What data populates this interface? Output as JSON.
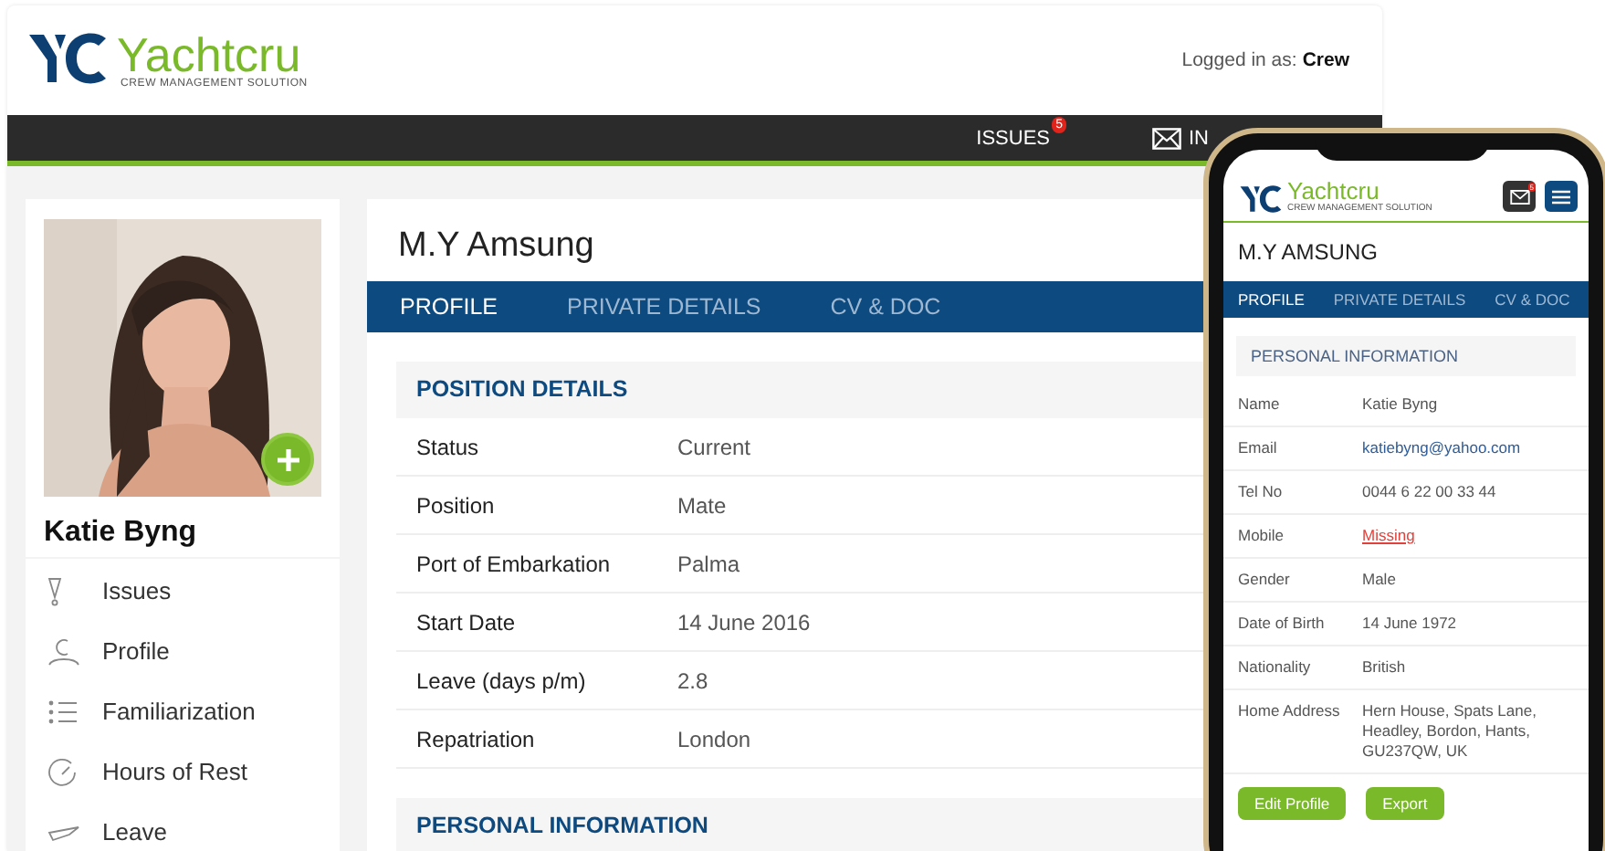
{
  "header": {
    "logo": {
      "name": "Yachtcru",
      "tagline": "CREW MANAGEMENT SOLUTION"
    },
    "login": {
      "label": "Logged in as:",
      "user": "Crew"
    }
  },
  "navbar": {
    "items": [
      {
        "label": "ISSUES",
        "badge": "5",
        "kind": "badge"
      },
      {
        "label": "IN",
        "kind": "mail"
      }
    ]
  },
  "profile": {
    "name": "Katie Byng"
  },
  "sidebar": {
    "items": [
      {
        "label": "Issues",
        "kind": "alert"
      },
      {
        "label": "Profile",
        "kind": "person"
      },
      {
        "label": "Familiarization",
        "kind": "list"
      },
      {
        "label": "Hours of Rest",
        "kind": "clock"
      },
      {
        "label": "Leave",
        "kind": "plane"
      }
    ]
  },
  "vessel": {
    "title": "M.Y Amsung"
  },
  "tabs": [
    {
      "label": "PROFILE",
      "selected": true
    },
    {
      "label": "PRIVATE DETAILS",
      "selected": false
    },
    {
      "label": "CV & DOC",
      "selected": false
    }
  ],
  "sections": [
    {
      "title": "POSITION DETAILS",
      "rows": [
        {
          "label": "Status",
          "value": "Current"
        },
        {
          "label": "Position",
          "value": "Mate"
        },
        {
          "label": "Port of Embarkation",
          "value": "Palma"
        },
        {
          "label": "Start Date",
          "value": "14 June 2016"
        },
        {
          "label": "Leave (days p/m)",
          "value": "2.8"
        },
        {
          "label": "Repatriation",
          "value": "London"
        }
      ]
    },
    {
      "title": "PERSONAL INFORMATION"
    }
  ],
  "phone": {
    "logo": {
      "name": "Yachtcru",
      "tagline": "CREW MANAGEMENT SOLUTION"
    },
    "mail_badge": "5",
    "title": "M.Y AMSUNG",
    "tabs": [
      {
        "label": "PROFILE",
        "selected": true
      },
      {
        "label": "PRIVATE DETAILS",
        "selected": false
      },
      {
        "label": "CV & DOC",
        "selected": false
      }
    ],
    "section_title": "PERSONAL INFORMATION",
    "rows": [
      {
        "label": "Name",
        "value": "Katie Byng",
        "kind": "text"
      },
      {
        "label": "Email",
        "value": "katiebyng@yahoo.com",
        "kind": "link"
      },
      {
        "label": "Tel No",
        "value": "0044 6 22 00 33 44",
        "kind": "text"
      },
      {
        "label": "Mobile",
        "value": "Missing",
        "kind": "warning"
      },
      {
        "label": "Gender",
        "value": "Male",
        "kind": "text"
      },
      {
        "label": "Date of Birth",
        "value": "14 June 1972",
        "kind": "text"
      },
      {
        "label": "Nationality",
        "value": "British",
        "kind": "text"
      },
      {
        "label": "Home Address",
        "value": "Hern House, Spats Lane, Headley, Bordon, Hants, GU237QW, UK",
        "kind": "text"
      }
    ],
    "buttons": [
      "Edit Profile",
      "Export"
    ]
  }
}
